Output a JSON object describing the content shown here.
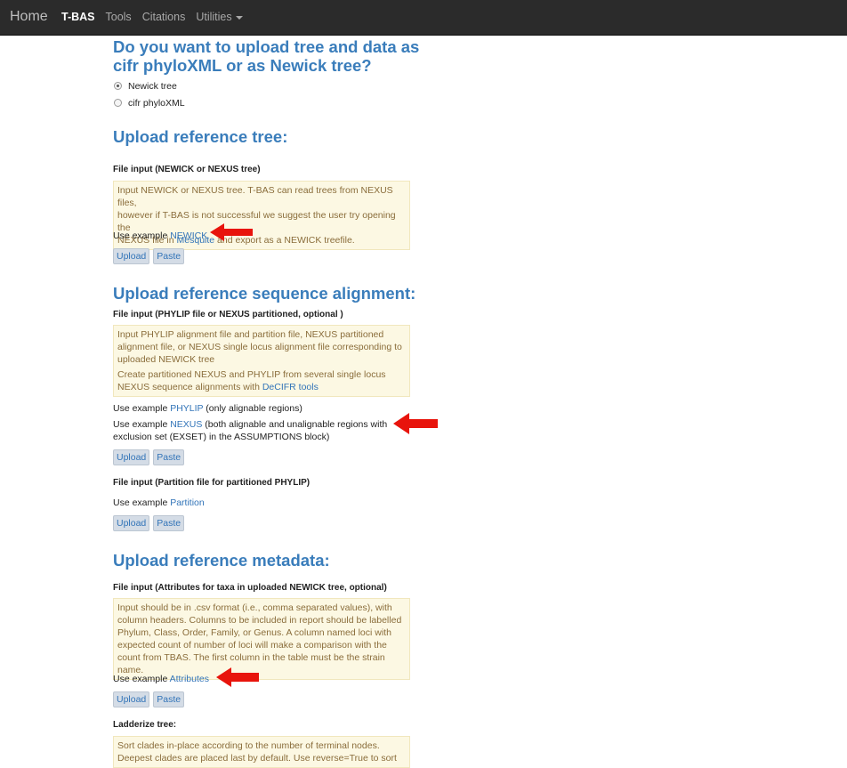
{
  "nav": {
    "brand": "Home",
    "items": [
      "T-BAS",
      "Tools",
      "Citations",
      "Utilities"
    ]
  },
  "format_question": {
    "title_line1": "Do you want to upload tree and data as",
    "title_line2": "cifr phyloXML or as Newick tree?",
    "options": [
      "Newick tree",
      "cifr phyloXML"
    ],
    "selected": "Newick tree"
  },
  "tree": {
    "title": "Upload reference tree:",
    "file_label": "File input (NEWICK or NEXUS tree)",
    "help_line1": "Input NEWICK or NEXUS tree. T-BAS can read trees from NEXUS files,",
    "help_line2": "however if T-BAS is not successful we suggest the user try opening the",
    "help_line3_pre": "NEXUS file in ",
    "help_line3_link": "Mesquite",
    "help_line3_post": " and export as a NEWICK treefile.",
    "example_prefix": "Use example ",
    "example_link": "NEWICK",
    "upload": "Upload",
    "paste": "Paste"
  },
  "alignment": {
    "title": "Upload reference sequence alignment:",
    "file_label": "File input (PHYLIP file or NEXUS partitioned, optional )",
    "help_line1": "Input PHYLIP alignment file and partition file, NEXUS partitioned",
    "help_line2": "alignment file, or NEXUS single locus alignment file corresponding to",
    "help_line3": "uploaded NEWICK tree",
    "help_line4": "Create partitioned NEXUS and PHYLIP from several single locus",
    "help_line5_pre": "NEXUS sequence alignments with ",
    "help_line5_link": "DeCIFR tools",
    "ex1_prefix": "Use example ",
    "ex1_link": "PHYLIP",
    "ex1_post": " (only alignable regions)",
    "ex2_prefix": "Use example ",
    "ex2_link": "NEXUS",
    "ex2_post": " (both alignable and unalignable regions with",
    "ex2_line2": "exclusion set (EXSET) in the ASSUMPTIONS block)",
    "upload": "Upload",
    "paste": "Paste",
    "partition_label": "File input (Partition file for partitioned PHYLIP)",
    "partition_prefix": "Use example ",
    "partition_link": "Partition",
    "upload2": "Upload",
    "paste2": "Paste"
  },
  "metadata": {
    "title": "Upload reference metadata:",
    "file_label": "File input (Attributes for taxa in uploaded NEWICK tree, optional)",
    "help_line1": "Input should be in .csv format (i.e., comma separated values), with",
    "help_line2": "column headers. Columns to be included in report should be labelled",
    "help_line3": "Phylum, Class, Order, Family, or Genus. A column named loci with",
    "help_line4": "expected count of number of loci will make a comparison with the",
    "help_line5": "count from TBAS. The first column in the table must be the strain name.",
    "example_prefix": "Use example ",
    "example_link": "Attributes",
    "upload": "Upload",
    "paste": "Paste"
  },
  "ladderize": {
    "label": "Ladderize tree:",
    "help_line1": "Sort clades in-place according to the number of terminal nodes.",
    "help_line2": "Deepest clades are placed last by default. Use reverse=True to sort"
  },
  "colors": {
    "heading": "#3a7dbb",
    "link": "#3274b8",
    "help_bg": "#fcf8e3",
    "help_text": "#8a6d3b",
    "arrow": "#e8140c",
    "navbar": "#2b2b2b"
  }
}
